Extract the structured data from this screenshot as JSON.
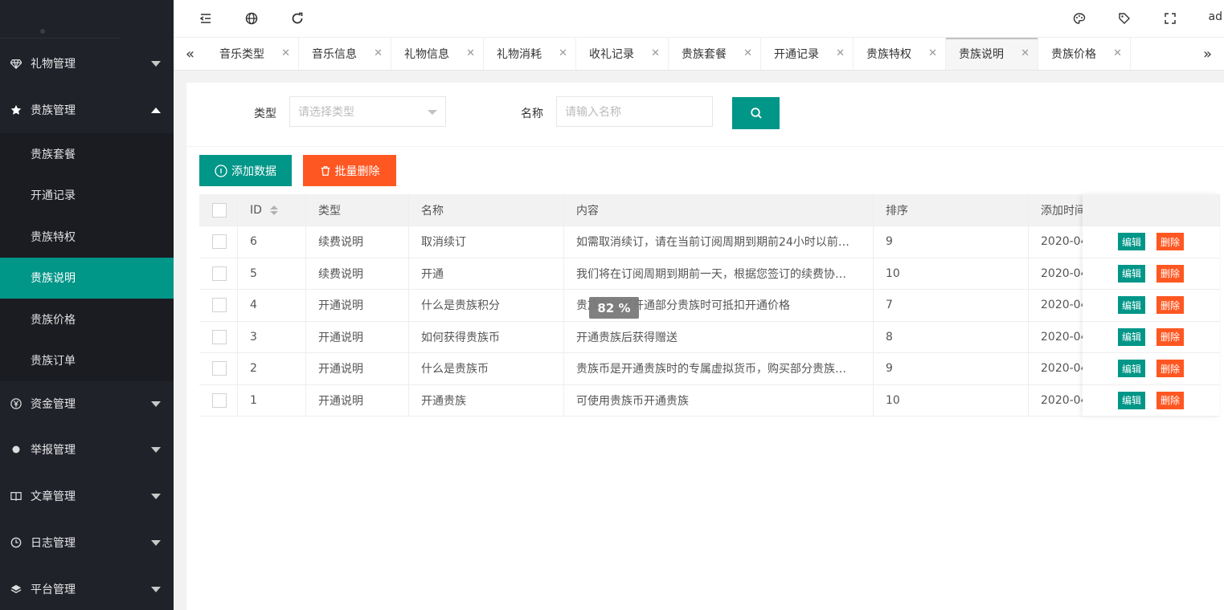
{
  "sidebar": {
    "groups_top": [
      {
        "label": "礼物管理",
        "icon": "diamond-icon",
        "expanded": false
      }
    ],
    "active_group": {
      "label": "贵族管理",
      "icon": "star-icon",
      "expanded": true
    },
    "sub_items": [
      {
        "label": "贵族套餐",
        "active": false
      },
      {
        "label": "开通记录",
        "active": false
      },
      {
        "label": "贵族特权",
        "active": false
      },
      {
        "label": "贵族说明",
        "active": true
      },
      {
        "label": "贵族价格",
        "active": false
      },
      {
        "label": "贵族订单",
        "active": false
      }
    ],
    "groups_bottom": [
      {
        "label": "资金管理",
        "icon": "yen-icon"
      },
      {
        "label": "举报管理",
        "icon": "gem-icon"
      },
      {
        "label": "文章管理",
        "icon": "book-icon"
      },
      {
        "label": "日志管理",
        "icon": "clock-icon"
      },
      {
        "label": "平台管理",
        "icon": "layers-icon"
      }
    ]
  },
  "header": {
    "user": "ad"
  },
  "tabs": [
    {
      "label": "音乐类型",
      "active": false
    },
    {
      "label": "音乐信息",
      "active": false
    },
    {
      "label": "礼物信息",
      "active": false
    },
    {
      "label": "礼物消耗",
      "active": false
    },
    {
      "label": "收礼记录",
      "active": false
    },
    {
      "label": "贵族套餐",
      "active": false
    },
    {
      "label": "开通记录",
      "active": false
    },
    {
      "label": "贵族特权",
      "active": false
    },
    {
      "label": "贵族说明",
      "active": true
    },
    {
      "label": "贵族价格",
      "active": false
    }
  ],
  "filter": {
    "type_label": "类型",
    "type_placeholder": "请选择类型",
    "name_label": "名称",
    "name_placeholder": "请输入名称"
  },
  "actions": {
    "add_label": "添加数据",
    "batch_delete_label": "批量删除"
  },
  "table": {
    "columns": [
      "ID",
      "类型",
      "名称",
      "内容",
      "排序",
      "添加时间"
    ],
    "rows": [
      {
        "id": "6",
        "type": "续费说明",
        "name": "取消续订",
        "content": "如需取消续订，请在当前订阅周期到期前24小时以前…",
        "sort": "9",
        "time": "2020-04"
      },
      {
        "id": "5",
        "type": "续费说明",
        "name": "开通",
        "content": "我们将在订阅周期到期前一天，根据您签订的续费协…",
        "sort": "10",
        "time": "2020-04"
      },
      {
        "id": "4",
        "type": "开通说明",
        "name": "什么是贵族积分",
        "content": "贵族积分可开通部分贵族时可抵扣开通价格",
        "sort": "7",
        "time": "2020-04"
      },
      {
        "id": "3",
        "type": "开通说明",
        "name": "如何获得贵族币",
        "content": "开通贵族后获得赠送",
        "sort": "8",
        "time": "2020-04"
      },
      {
        "id": "2",
        "type": "开通说明",
        "name": "什么是贵族币",
        "content": "贵族币是开通贵族时的专属虚拟货币，购买部分贵族…",
        "sort": "9",
        "time": "2020-04"
      },
      {
        "id": "1",
        "type": "开通说明",
        "name": "开通贵族",
        "content": "可使用贵族币开通贵族",
        "sort": "10",
        "time": "2020-04"
      }
    ],
    "edit_label": "编辑",
    "delete_label": "删除"
  },
  "loading": {
    "text": "82 %"
  },
  "colors": {
    "primary": "#009688",
    "danger": "#ff5722",
    "sidebar_bg": "#20222a"
  }
}
